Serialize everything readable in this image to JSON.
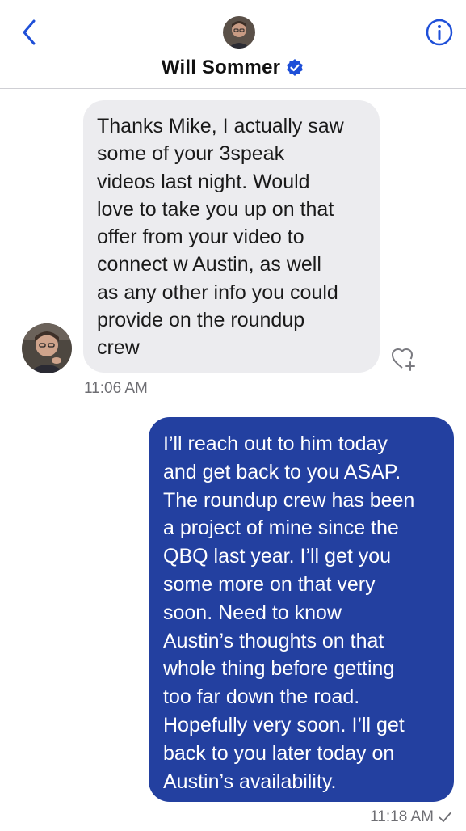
{
  "header": {
    "title": "Will Sommer",
    "verified": true,
    "icons": {
      "back": "chevron-left-icon",
      "info": "info-circle-icon",
      "verified": "verified-badge-icon"
    }
  },
  "messages": [
    {
      "direction": "incoming",
      "text": "Thanks Mike, I actually saw\nsome of your 3speak\nvideos last night. Would\nlove to take you up on that\noffer from your video to\nconnect w Austin, as well\nas any other info you could\nprovide on the roundup\ncrew",
      "time": "11:06 AM",
      "react_icon": "heart-plus-icon"
    },
    {
      "direction": "outgoing",
      "text": "I’ll reach out to him today\nand get back to you ASAP.\nThe roundup crew has been\na project of mine since the\nQBQ last year. I’ll get you\nsome more on that very\nsoon. Need to know\nAustin’s thoughts on that\nwhole thing before getting\ntoo far down the road.\nHopefully very soon. I’ll get\nback to you later today on\nAustin’s availability.",
      "time": "11:18 AM",
      "status_icon": "checkmark-icon"
    }
  ],
  "colors": {
    "accent": "#1e4fd8",
    "outgoing_bubble": "#2340a0",
    "incoming_bubble": "#ececef",
    "timestamp": "#6e6e73"
  }
}
